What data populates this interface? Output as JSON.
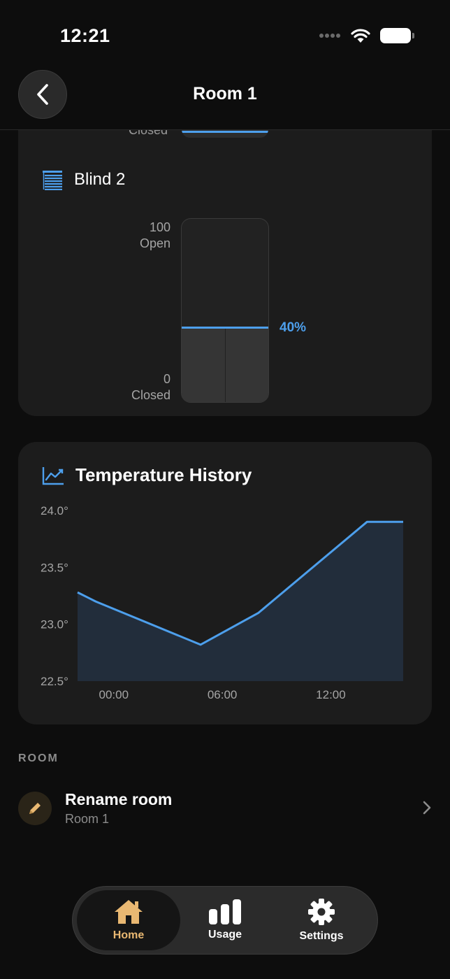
{
  "status": {
    "time": "12:21"
  },
  "nav": {
    "title": "Room 1"
  },
  "previous_blind": {
    "closed_label": "Closed"
  },
  "blind": {
    "name": "Blind 2",
    "top_value": "100",
    "top_label": "Open",
    "bottom_value": "0",
    "bottom_label": "Closed",
    "position_percent": 40,
    "position_label": "40%"
  },
  "temperature": {
    "title": "Temperature History",
    "colors": {
      "line": "#4d9fec",
      "fill": "#222d3b"
    }
  },
  "chart_data": {
    "type": "area",
    "title": "Temperature History",
    "xlabel": "",
    "ylabel": "",
    "ylim": [
      22.5,
      24.0
    ],
    "yticks": [
      "24.0°",
      "23.5°",
      "23.0°",
      "22.5°"
    ],
    "ytick_values": [
      24.0,
      23.5,
      23.0,
      22.5
    ],
    "xlim": [
      -2.0,
      16.0
    ],
    "xticks": [
      "00:00",
      "06:00",
      "12:00"
    ],
    "xtick_values": [
      0,
      6,
      12
    ],
    "grid": false,
    "legend": "none",
    "series": [
      {
        "x": [
          -2.0,
          -1.0,
          4.8,
          8.0,
          14.0,
          16.0
        ],
        "values": [
          23.28,
          23.2,
          22.82,
          23.1,
          23.9,
          23.9
        ]
      }
    ]
  },
  "room_section": {
    "label": "ROOM",
    "rename": {
      "title": "Rename room",
      "subtitle": "Room 1"
    }
  },
  "tabs": [
    {
      "label": "Home",
      "icon": "house-icon",
      "active": true
    },
    {
      "label": "Usage",
      "icon": "bar-chart-icon",
      "active": false
    },
    {
      "label": "Settings",
      "icon": "gear-icon",
      "active": false
    }
  ],
  "colors": {
    "accent": "#4d9fec",
    "active_tab": "#e9b872"
  }
}
